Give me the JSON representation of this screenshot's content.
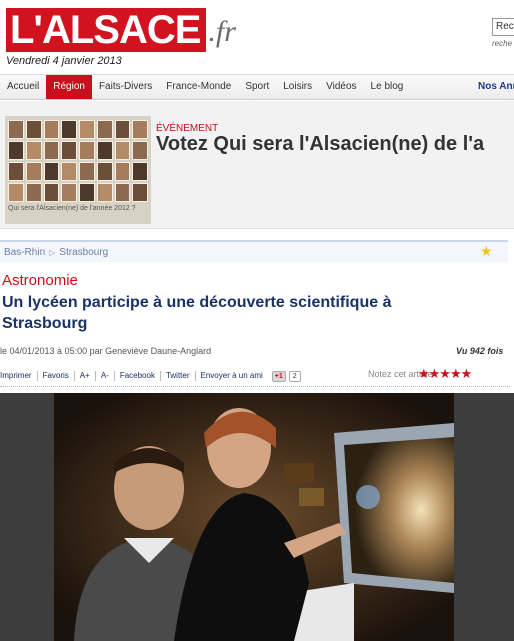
{
  "header": {
    "logo_text": "L'ALSACE",
    "logo_suffix": ".fr",
    "date": "Vendredi 4 janvier 2013",
    "search_value": "Rech",
    "search_sub": "reche"
  },
  "nav": {
    "items": [
      "Accueil",
      "Région",
      "Faits-Divers",
      "France-Monde",
      "Sport",
      "Loisirs",
      "Vidéos",
      "Le blog"
    ],
    "active": "Région",
    "right_link": "Nos Ann"
  },
  "event": {
    "kicker": "ÉVÉNEMENT",
    "title": "Votez Qui sera l'Alsacien(ne) de l'a",
    "thumb_caption": "Qui sera l'Alsacien(ne) de l'année 2012 ?"
  },
  "breadcrumb": [
    "Bas-Rhin",
    "Strasbourg"
  ],
  "article": {
    "kicker": "Astronomie",
    "headline": "Un lycéen participe à une découverte scientifique à Strasbourg",
    "meta": "le 04/01/2013 à 05:00 par Geneviève Daune-Anglard",
    "views": "Vu 942 fois"
  },
  "tools": {
    "items": [
      "Imprimer",
      "Favoris",
      "A+",
      "A-",
      "Facebook",
      "Twitter",
      "Envoyer à un ami"
    ],
    "gplus_label": "+1",
    "gplus_count": "2",
    "rate_label": "Notez cet article",
    "rate_stars": "★★★★★"
  },
  "icons": {
    "favorite_star": "★",
    "breadcrumb_sep": "▷"
  },
  "colors": {
    "brand_red": "#d2121e",
    "headline_blue": "#1a3265"
  }
}
